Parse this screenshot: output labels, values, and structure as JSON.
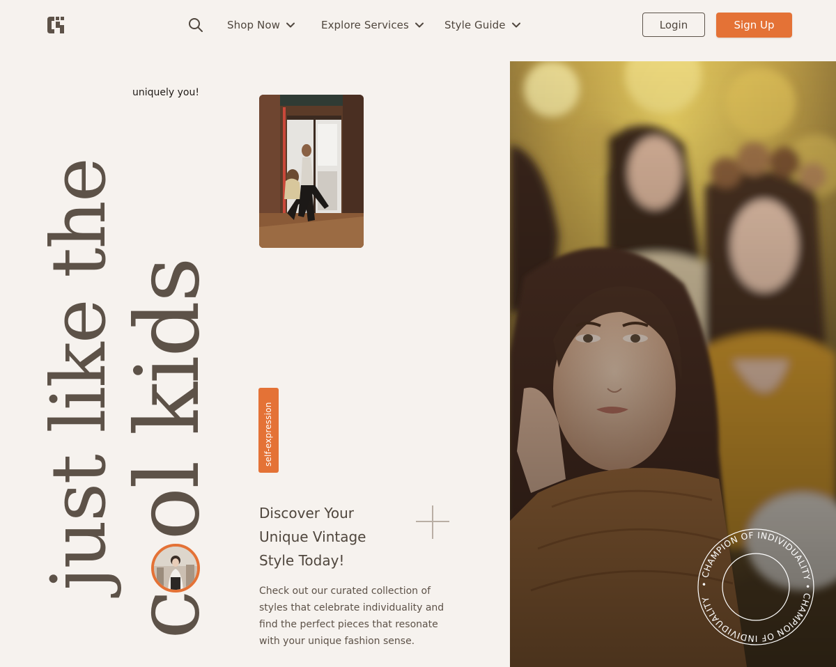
{
  "header": {
    "nav": [
      {
        "label": "Shop Now"
      },
      {
        "label": "Explore Services"
      },
      {
        "label": "Style Guide"
      }
    ],
    "login_label": "Login",
    "signup_label": "Sign Up"
  },
  "hero": {
    "tagline": "uniquely you!",
    "line1": "just like the",
    "line2": "cool kids",
    "badge": "self-expression",
    "headline": "Discover Your\nUnique Vintage\nStyle Today!",
    "description": "Check out our curated collection of styles that celebrate individuality and find the perfect pieces that resonate with your unique fashion sense.",
    "seal_text": "• CHAMPION OF INDIVIDUALITY • CHAMPION OF INDIVIDUALITY"
  },
  "colors": {
    "background": "#f6f2ee",
    "accent": "#e47236",
    "text": "#4f463d"
  },
  "icons": [
    "brand-logo-icon",
    "search-icon",
    "chevron-down-icon",
    "plus-icon"
  ]
}
